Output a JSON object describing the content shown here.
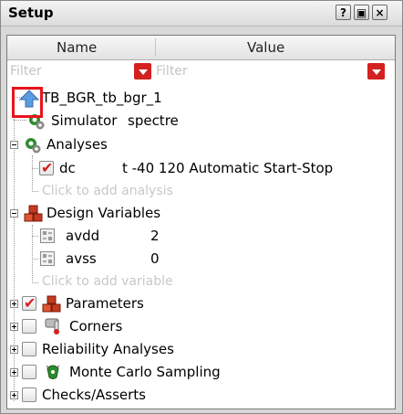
{
  "window": {
    "title": "Setup",
    "buttons": {
      "help": "?",
      "float": "▣",
      "close": "×"
    }
  },
  "columns": {
    "name": "Name",
    "value": "Value"
  },
  "filters": {
    "name_placeholder": "Filter",
    "value_placeholder": "Filter"
  },
  "tree": {
    "testbench": {
      "label": "TB_BGR_tb_bgr_1",
      "icon": "up-arrow-icon"
    },
    "simulator": {
      "label": "Simulator",
      "value": "spectre",
      "icon": "gear-icon"
    },
    "analyses": {
      "label": "Analyses",
      "icon": "gear-icon",
      "items": [
        {
          "name": "dc",
          "value": "t -40 120 Automatic Start-Stop",
          "checked": true
        }
      ],
      "add_hint": "Click to add analysis"
    },
    "design_variables": {
      "label": "Design Variables",
      "icon": "variables-icon",
      "items": [
        {
          "name": "avdd",
          "value": "2"
        },
        {
          "name": "avss",
          "value": "0"
        }
      ],
      "add_hint": "Click to add variable"
    },
    "parameters": {
      "label": "Parameters",
      "checked": true,
      "icon": "variables-icon"
    },
    "corners": {
      "label": "Corners",
      "checked": false,
      "icon": "thermometer-icon"
    },
    "reliability": {
      "label": "Reliability Analyses",
      "checked": false
    },
    "monte_carlo": {
      "label": "Monte Carlo Sampling",
      "checked": false,
      "icon": "dice-icon"
    },
    "checks": {
      "label": "Checks/Asserts",
      "checked": false
    }
  },
  "colors": {
    "accent_red": "#d42020",
    "highlight": "#e8141b",
    "icon_blue": "#4f8fd6",
    "icon_green": "#2e8b2e"
  }
}
